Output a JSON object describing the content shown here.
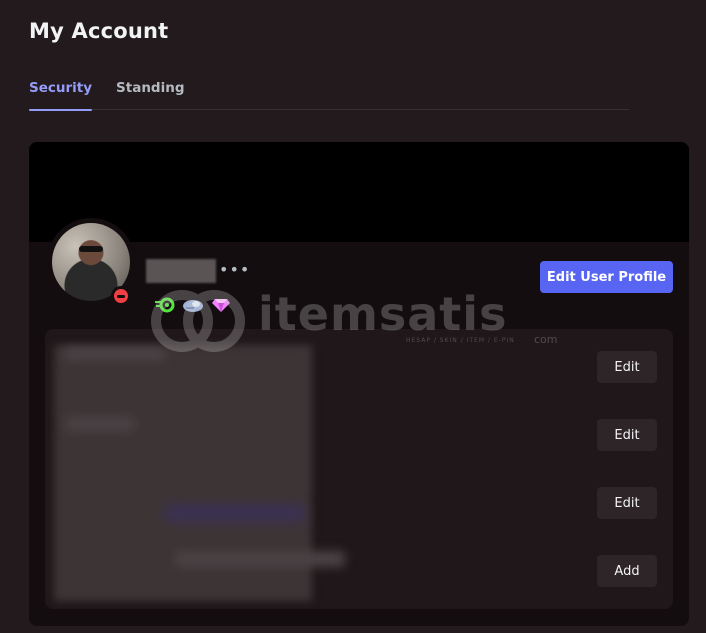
{
  "header": {
    "title": "My Account"
  },
  "tabs": [
    {
      "label": "Security",
      "active": true
    },
    {
      "label": "Standing",
      "active": false
    }
  ],
  "profile": {
    "username_suffix": "•••",
    "status": "dnd",
    "status_color": "#f23f43",
    "badges": [
      "nitro-badge-icon",
      "quest-badge-icon",
      "gem-badge-icon"
    ],
    "edit_profile_label": "Edit User Profile",
    "accent_color": "#5865f2"
  },
  "fields": [
    {
      "action_label": "Edit"
    },
    {
      "action_label": "Edit"
    },
    {
      "action_label": "Edit"
    },
    {
      "action_label": "Add"
    }
  ],
  "watermark": {
    "brand": "itemsatis",
    "tagline": "HESAP / SKIN / ITEM / E-PIN",
    "suffix": "com"
  }
}
